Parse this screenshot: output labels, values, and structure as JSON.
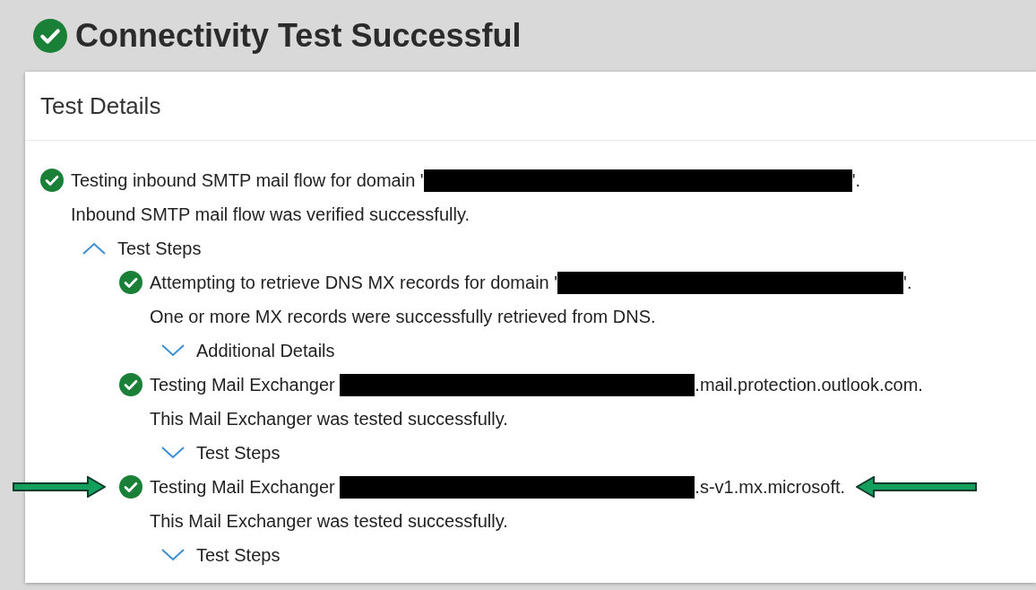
{
  "header": {
    "title": "Connectivity Test Successful",
    "passed": true
  },
  "panel": {
    "title": "Test Details",
    "result": {
      "passed": true,
      "highlighted": false,
      "parts": [
        {
          "kind": "text",
          "text": "Testing inbound SMTP mail flow for domain '"
        },
        {
          "kind": "redacted"
        },
        {
          "kind": "text",
          "text": "'."
        }
      ],
      "message": "Inbound SMTP mail flow was verified successfully.",
      "toggle": {
        "label": "Test Steps",
        "expanded": true
      },
      "children": [
        {
          "passed": true,
          "highlighted": false,
          "parts": [
            {
              "kind": "text",
              "text": "Attempting to retrieve DNS MX records for domain '"
            },
            {
              "kind": "redacted"
            },
            {
              "kind": "text",
              "text": "'."
            }
          ],
          "message": "One or more MX records were successfully retrieved from DNS.",
          "toggle": {
            "label": "Additional Details",
            "expanded": false
          }
        },
        {
          "passed": true,
          "highlighted": false,
          "parts": [
            {
              "kind": "text",
              "text": "Testing Mail Exchanger "
            },
            {
              "kind": "redacted"
            },
            {
              "kind": "text",
              "text": ".mail.protection.outlook.com."
            }
          ],
          "message": "This Mail Exchanger was tested successfully.",
          "toggle": {
            "label": "Test Steps",
            "expanded": false
          }
        },
        {
          "passed": true,
          "highlighted": true,
          "parts": [
            {
              "kind": "text",
              "text": "Testing Mail Exchanger "
            },
            {
              "kind": "redacted"
            },
            {
              "kind": "text",
              "text": ".s-v1.mx.microsoft."
            }
          ],
          "message": "This Mail Exchanger was tested successfully.",
          "toggle": {
            "label": "Test Steps",
            "expanded": false
          }
        }
      ]
    }
  }
}
